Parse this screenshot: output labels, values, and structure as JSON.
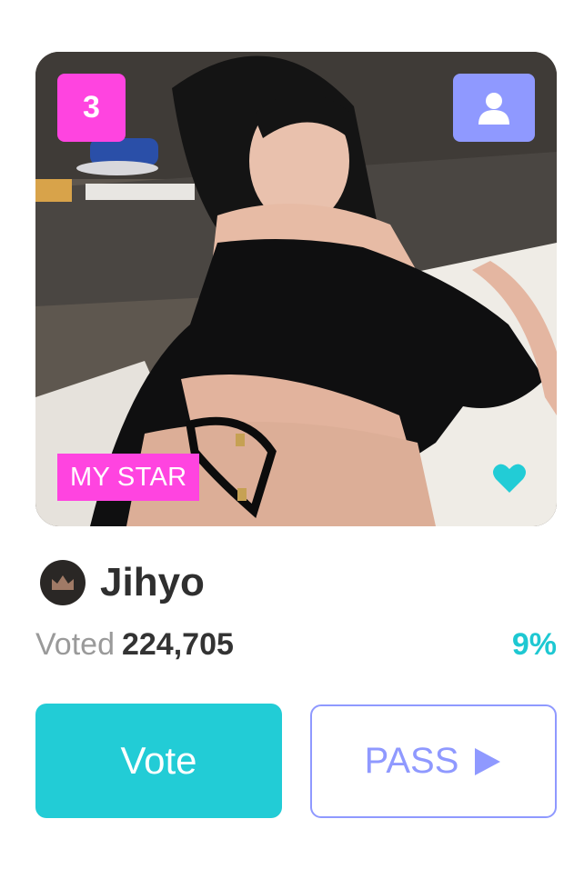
{
  "card": {
    "rank": "3",
    "my_star_label": "MY STAR",
    "profile_icon": "person-icon",
    "favorite_icon": "heart-icon"
  },
  "star": {
    "name": "Jihyo",
    "badge_icon": "crown-icon"
  },
  "stats": {
    "voted_label": "Voted",
    "vote_count": "224,705",
    "percent": "9%"
  },
  "actions": {
    "vote_label": "Vote",
    "pass_label": "PASS",
    "pass_icon": "play-arrow-icon"
  },
  "colors": {
    "pink": "#ff44e0",
    "periwinkle": "#8f99ff",
    "teal": "#22ccd6"
  }
}
